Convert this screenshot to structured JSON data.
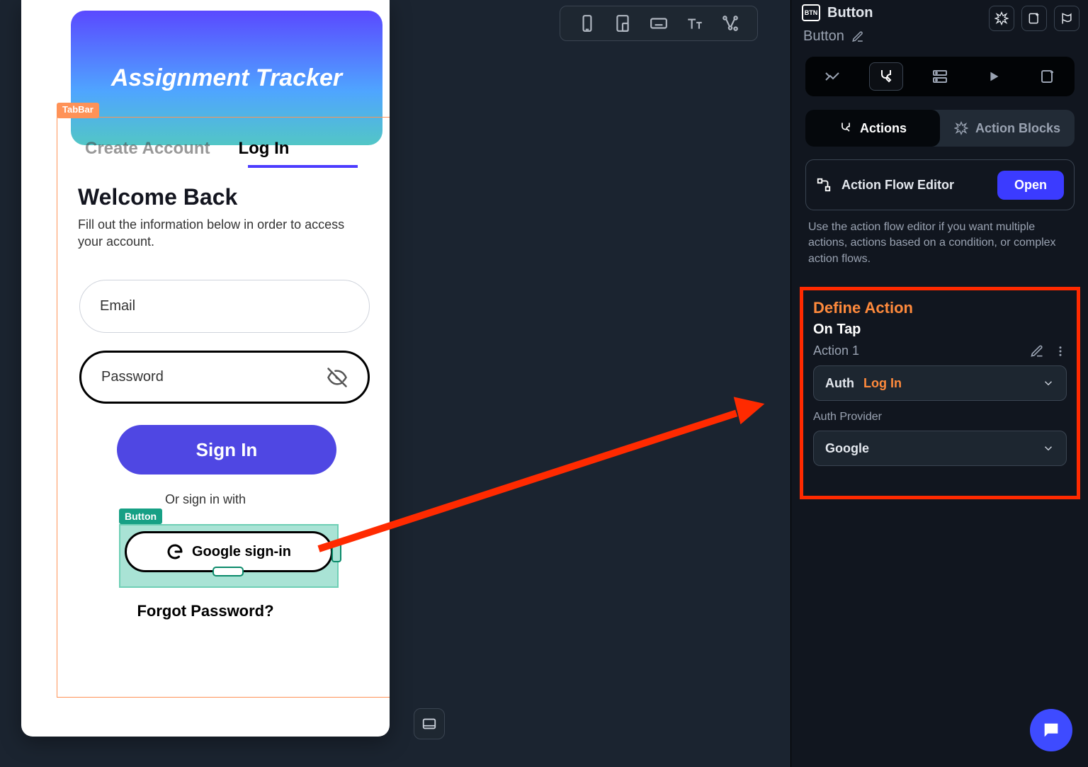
{
  "preview": {
    "appTitle": "Assignment Tracker",
    "tabbarTag": "TabBar",
    "tabs": {
      "createAccount": "Create Account",
      "login": "Log In"
    },
    "welcomeHeading": "Welcome Back",
    "welcomeBody": "Fill out the information below in order to access your account.",
    "emailPlaceholder": "Email",
    "passwordPlaceholder": "Password",
    "signInLabel": "Sign In",
    "orLabel": "Or sign in with",
    "buttonTag": "Button",
    "googleLabel": "Google sign-in",
    "forgotLabel": "Forgot Password?"
  },
  "rpanel": {
    "componentBadge": "BTN",
    "componentType": "Button",
    "componentName": "Button",
    "segActions": "Actions",
    "segBlocks": "Action Blocks",
    "afeLabel": "Action Flow Editor",
    "openLabel": "Open",
    "hint": "Use the action flow editor if you want multiple actions, actions based on a condition, or complex action flows.",
    "defineHeading": "Define Action",
    "trigger": "On Tap",
    "actionNumber": "Action 1",
    "actionCategory": "Auth",
    "actionName": "Log In",
    "providerLabel": "Auth Provider",
    "providerValue": "Google"
  }
}
